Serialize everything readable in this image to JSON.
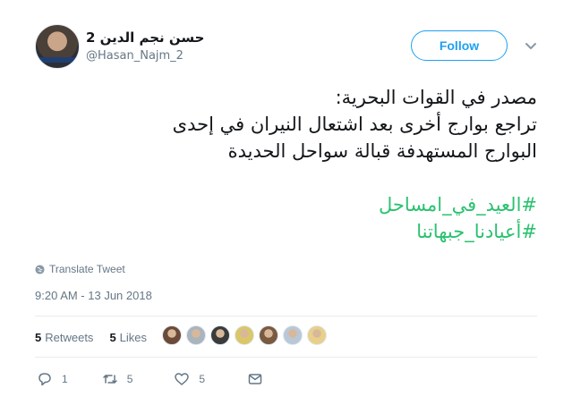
{
  "author": {
    "name": "حسن نجم الدين 2",
    "handle": "@Hasan_Najm_2"
  },
  "follow_label": "Follow",
  "tweet": {
    "lines": [
      "مصدر في القوات البحرية:",
      "تراجع بوارج أخرى بعد اشتعال النيران في إحدى",
      "البوارج المستهدفة قبالة سواحل الحديدة"
    ],
    "hashtags": [
      "#العيد_في_امساحل",
      "#أعيادنا_جبهاتنا"
    ]
  },
  "translate_label": "Translate Tweet",
  "timestamp": "9:20 AM - 13 Jun 2018",
  "stats": {
    "retweets_count": "5",
    "retweets_label": "Retweets",
    "likes_count": "5",
    "likes_label": "Likes"
  },
  "liker_avatar_colors": [
    "#6b4a3a",
    "#aab4bd",
    "#3b3b3b",
    "#d9c76a",
    "#7a5a40",
    "#b9c7d6",
    "#e8d08a"
  ],
  "actions": {
    "reply_count": "1",
    "retweet_count": "5",
    "like_count": "5"
  },
  "colors": {
    "accent": "#1da1f2",
    "hashtag": "#2ac26f",
    "secondary_text": "#657786"
  }
}
